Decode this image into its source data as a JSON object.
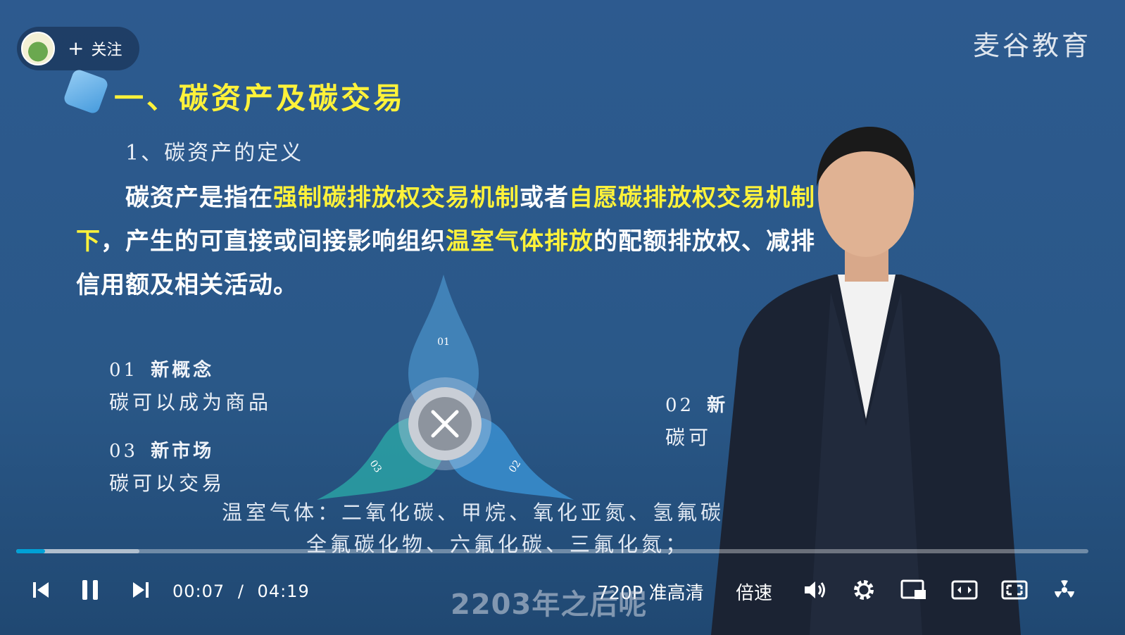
{
  "player": {
    "channel": {
      "follow_label": "关注",
      "logo_icon": "channel-logo-icon"
    },
    "watermark": "麦谷教育"
  },
  "slide": {
    "title": "一、碳资产及碳交易",
    "subtitle": "1、碳资产的定义",
    "definition_segments": [
      {
        "text": "碳资产是指在",
        "highlight": false
      },
      {
        "text": "强制碳排放权交易机制",
        "highlight": true
      },
      {
        "text": "或者",
        "highlight": false
      },
      {
        "text": "自愿碳排放权交易机制下",
        "highlight": true
      },
      {
        "text": "，产生的可直接或间接影响组织",
        "highlight": false
      },
      {
        "text": "温室气体排放",
        "highlight": true
      },
      {
        "text": "的配额排放权、减排信用额及相关活动。",
        "highlight": false
      }
    ],
    "items": [
      {
        "num": "01",
        "head": "新概念",
        "body": "碳可以成为商品"
      },
      {
        "num": "02",
        "head": "新",
        "body": "碳可"
      },
      {
        "num": "03",
        "head": "新市场",
        "body": "碳可以交易"
      }
    ],
    "petals": {
      "p1": "01",
      "p2": "02",
      "p3": "03"
    },
    "center_icon": "tools-icon",
    "gases_line1": "温室气体：二氧化碳、甲烷、氧化亚氮、氢氟碳",
    "gases_line2": "全氟碳化物、六氟化碳、三氟化氮；"
  },
  "progress": {
    "played_fraction": 0.027,
    "buffered_fraction": 0.115
  },
  "controls": {
    "current_time": "00:07",
    "separator": "/",
    "duration": "04:19",
    "quality": "720P 准高清",
    "speed_label": "倍速"
  },
  "caption": "2203年之后呢",
  "colors": {
    "highlight": "#fff23a",
    "accent": "#00a1d6"
  }
}
